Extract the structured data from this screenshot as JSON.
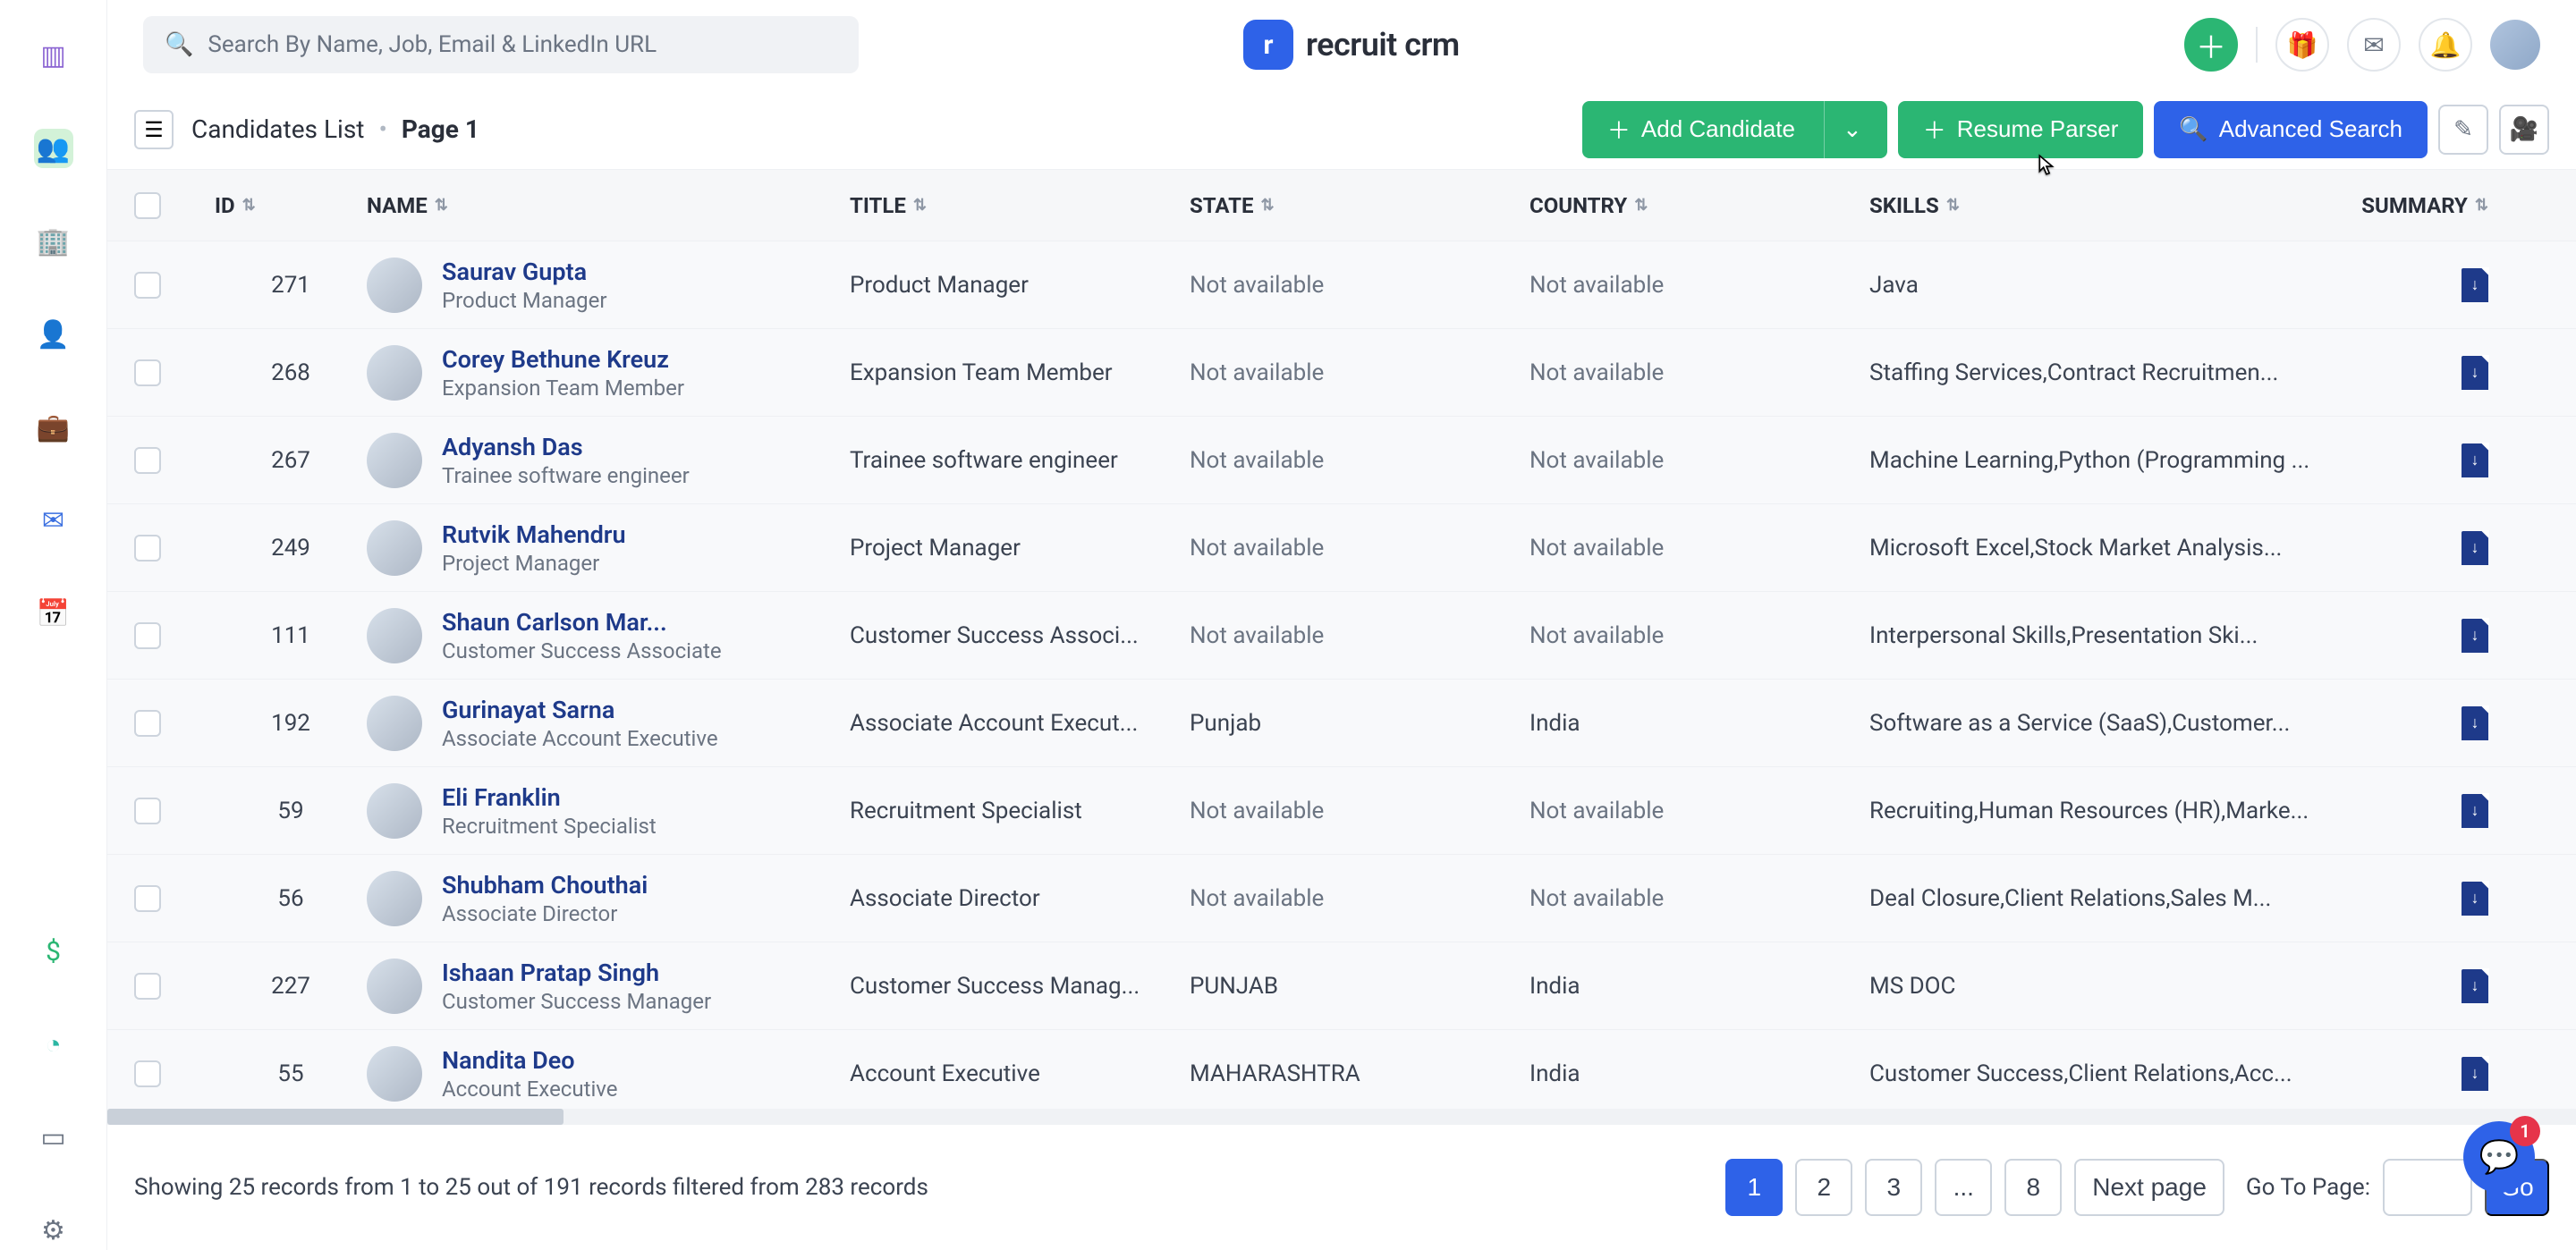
{
  "brand": {
    "name": "recruit crm",
    "logo_letter": "r"
  },
  "search": {
    "placeholder": "Search By Name, Job, Email & LinkedIn URL"
  },
  "toolbar": {
    "list_label": "Candidates List",
    "page_label": "Page 1",
    "add_candidate": "Add Candidate",
    "resume_parser": "Resume Parser",
    "advanced_search": "Advanced Search"
  },
  "columns": {
    "id": "ID",
    "name": "NAME",
    "title": "TITLE",
    "state": "STATE",
    "country": "COUNTRY",
    "skills": "SKILLS",
    "summary": "SUMMARY"
  },
  "rows": [
    {
      "id": "271",
      "name": "Saurav Gupta",
      "sub": "Product Manager",
      "title": "Product Manager",
      "state": "Not available",
      "country": "Not available",
      "skills": "Java"
    },
    {
      "id": "268",
      "name": "Corey Bethune Kreuz",
      "sub": "Expansion Team Member",
      "title": "Expansion Team Member",
      "state": "Not available",
      "country": "Not available",
      "skills": "Staffing Services,Contract Recruitmen..."
    },
    {
      "id": "267",
      "name": "Adyansh Das",
      "sub": "Trainee software engineer",
      "title": "Trainee software engineer",
      "state": "Not available",
      "country": "Not available",
      "skills": "Machine Learning,Python (Programming ..."
    },
    {
      "id": "249",
      "name": "Rutvik Mahendru",
      "sub": "Project Manager",
      "title": "Project Manager",
      "state": "Not available",
      "country": "Not available",
      "skills": "Microsoft Excel,Stock Market Analysis..."
    },
    {
      "id": "111",
      "name": "Shaun Carlson Mar...",
      "sub": "Customer Success Associate",
      "title": "Customer Success Associ...",
      "state": "Not available",
      "country": "Not available",
      "skills": "Interpersonal Skills,Presentation Ski..."
    },
    {
      "id": "192",
      "name": "Gurinayat Sarna",
      "sub": "Associate Account Executive",
      "title": "Associate Account Execut...",
      "state": "Punjab",
      "country": "India",
      "skills": "Software as a Service (SaaS),Customer..."
    },
    {
      "id": "59",
      "name": "Eli Franklin",
      "sub": "Recruitment Specialist",
      "title": "Recruitment Specialist",
      "state": "Not available",
      "country": "Not available",
      "skills": "Recruiting,Human Resources (HR),Marke..."
    },
    {
      "id": "56",
      "name": "Shubham Chouthai",
      "sub": "Associate Director",
      "title": "Associate Director",
      "state": "Not available",
      "country": "Not available",
      "skills": "Deal Closure,Client Relations,Sales M..."
    },
    {
      "id": "227",
      "name": "Ishaan Pratap Singh",
      "sub": "Customer Success Manager",
      "title": "Customer Success Manag...",
      "state": "PUNJAB",
      "country": "India",
      "skills": "MS DOC"
    },
    {
      "id": "55",
      "name": "Nandita Deo",
      "sub": "Account Executive",
      "title": "Account Executive",
      "state": "MAHARASHTRA",
      "country": "India",
      "skills": "Customer Success,Client Relations,Acc..."
    }
  ],
  "footer": {
    "summary": "Showing 25 records from 1 to 25 out of 191 records filtered from 283 records",
    "pages": [
      "1",
      "2",
      "3",
      "...",
      "8"
    ],
    "next": "Next page",
    "goto_label": "Go To Page:",
    "go": "Go"
  },
  "chat": {
    "badge": "1"
  }
}
